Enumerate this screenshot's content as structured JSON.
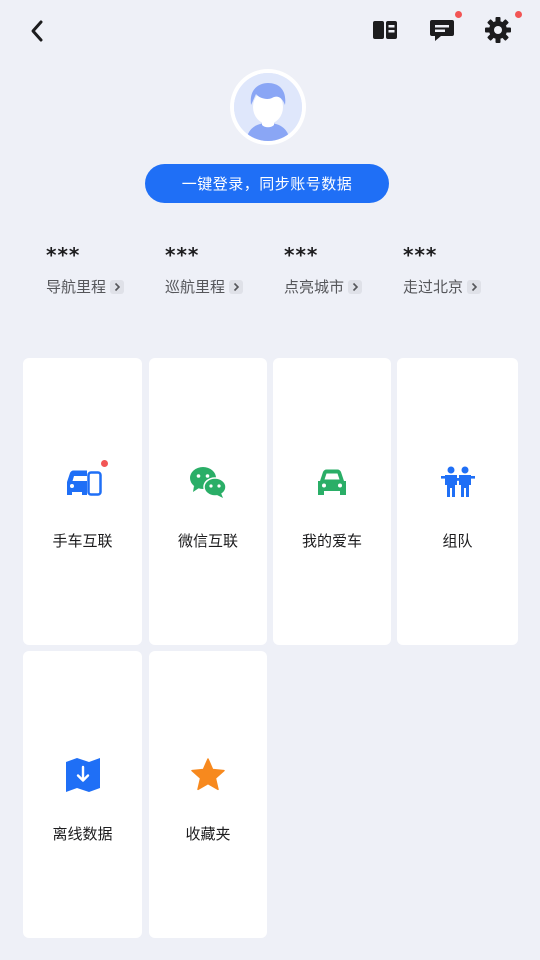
{
  "header": {
    "back_icon": "chevron-left-icon",
    "actions": [
      {
        "icon": "book-icon",
        "badge": false
      },
      {
        "icon": "message-icon",
        "badge": true
      },
      {
        "icon": "gear-icon",
        "badge": true
      }
    ]
  },
  "profile": {
    "avatar_icon": "default-avatar-icon",
    "login_label": "一键登录，同步账号数据"
  },
  "stats": [
    {
      "value": "***",
      "label": "导航里程"
    },
    {
      "value": "***",
      "label": "巡航里程"
    },
    {
      "value": "***",
      "label": "点亮城市"
    },
    {
      "value": "***",
      "label": "走过北京"
    }
  ],
  "features": [
    {
      "label": "手车互联",
      "icon": "car-phone-icon",
      "color": "#1f6ff6",
      "badge": true
    },
    {
      "label": "微信互联",
      "icon": "wechat-icon",
      "color": "#2aae67",
      "badge": false
    },
    {
      "label": "我的爱车",
      "icon": "car-icon",
      "color": "#2aae67",
      "badge": false
    },
    {
      "label": "组队",
      "icon": "team-icon",
      "color": "#1f6ff6",
      "badge": false
    },
    {
      "label": "离线数据",
      "icon": "offline-map-icon",
      "color": "#1f6ff6",
      "badge": false
    },
    {
      "label": "收藏夹",
      "icon": "star-icon",
      "color": "#f7891e",
      "badge": false
    }
  ],
  "colors": {
    "accent": "#1f6ff6",
    "badge": "#f25555",
    "background": "#eef0f7"
  }
}
